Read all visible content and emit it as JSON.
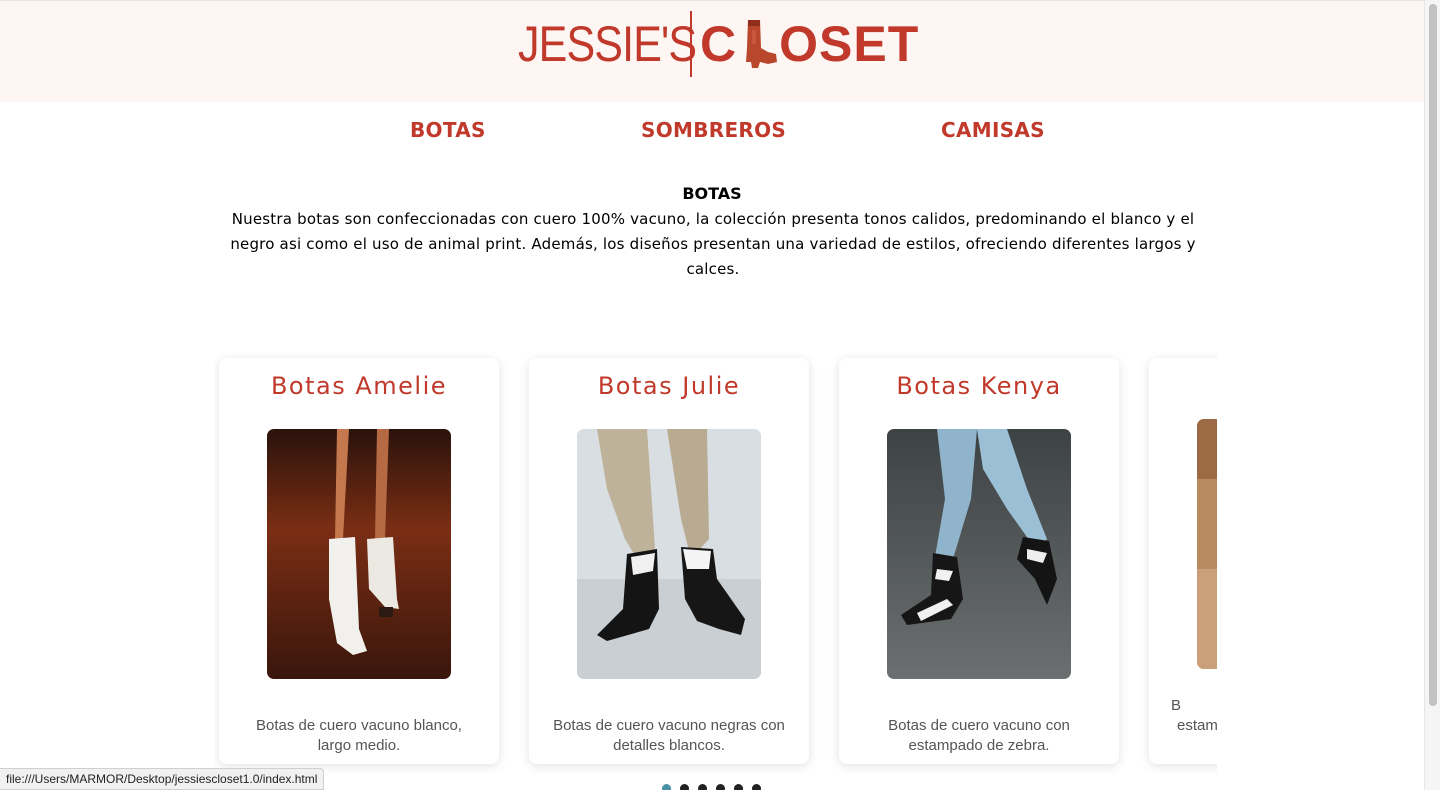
{
  "brand": {
    "name_left": "JESSIE'S",
    "name_right_start": "C",
    "name_right_end": "OSET",
    "color": "#c0392b"
  },
  "nav": {
    "items": [
      {
        "label": "BOTAS"
      },
      {
        "label": "SOMBREROS"
      },
      {
        "label": "CAMISAS"
      }
    ]
  },
  "section": {
    "title": "BOTAS",
    "description": "Nuestra botas son confeccionadas con cuero 100% vacuno, la colección presenta tonos calidos, predominando el blanco y el negro asi como el uso de animal print. Además, los diseños presentan una variedad de estilos, ofreciendo diferentes largos y calces."
  },
  "products": [
    {
      "title": "Botas Amelie",
      "description": "Botas de cuero vacuno blanco, largo medio.",
      "image": "white-cowboy-boots-photo"
    },
    {
      "title": "Botas Julie",
      "description": "Botas de cuero vacuno negras con detalles blancos.",
      "image": "black-white-boots-photo"
    },
    {
      "title": "Botas Kenya",
      "description": "Botas de cuero vacuno con estampado de zebra.",
      "image": "zebra-print-boots-photo"
    },
    {
      "title": "",
      "description": "estam",
      "description_first": "B",
      "image": "partial-boots-photo"
    }
  ],
  "carousel": {
    "dot_count": 6,
    "active_index": 0,
    "active_color": "#4a90a4"
  },
  "status": {
    "url": "file:///Users/MARMOR/Desktop/jessiescloset1.0/index.html"
  }
}
